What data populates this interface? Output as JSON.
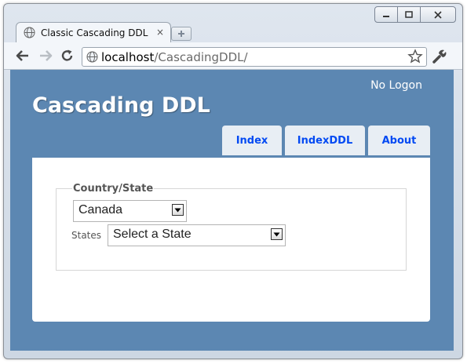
{
  "browser": {
    "tab_title": "Classic Cascading DDL",
    "tab_close": "×",
    "url_host": "localhost",
    "url_path": "/CascadingDDL/",
    "icons": [
      "back-icon",
      "forward-icon",
      "reload-icon",
      "globe-icon",
      "star-icon",
      "wrench-icon",
      "minimize-icon",
      "maximize-icon",
      "close-icon"
    ]
  },
  "page": {
    "logon": "No Logon",
    "site_title": "Cascading DDL",
    "menu": [
      {
        "label": "Index"
      },
      {
        "label": "IndexDDL"
      },
      {
        "label": "About"
      }
    ],
    "form": {
      "legend": "Country/State",
      "country_value": "Canada",
      "states_label": "States",
      "state_value": "Select a State"
    }
  },
  "colors": {
    "page_background": "#5c87b2",
    "menu_link": "#034af3",
    "menu_tab": "#e8eef4"
  }
}
